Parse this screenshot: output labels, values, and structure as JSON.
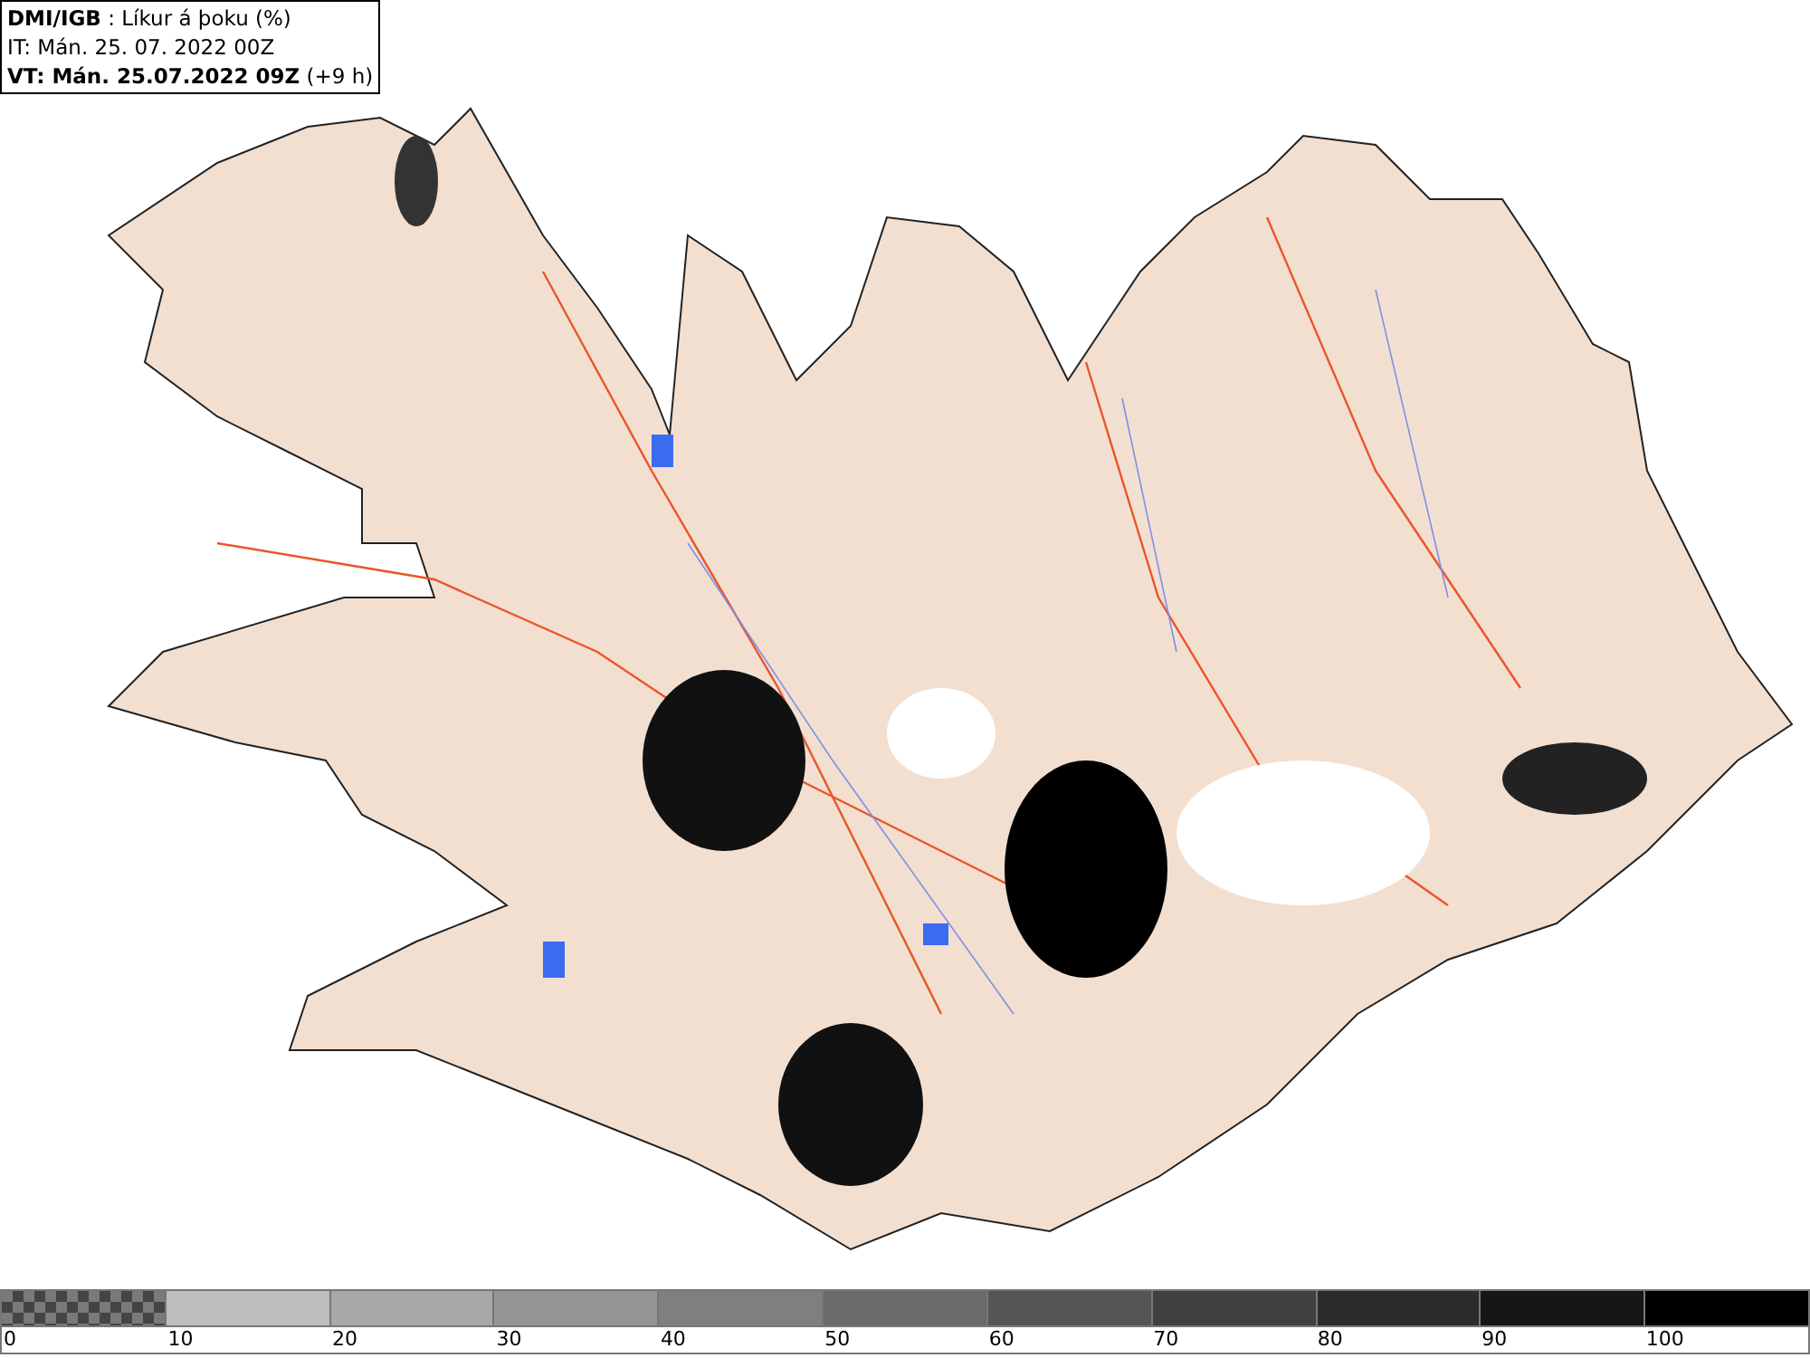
{
  "header": {
    "lines": [
      "**DMI/IGB** : Líkur á þoku (%)",
      "IT: Mán. 25. 07. 2022 00Z",
      "**VT: Mán. 25.07.2022 09Z** (+9 h)"
    ]
  },
  "legend": {
    "segments": [
      {
        "kind": "checker",
        "color": "#7a7a7a"
      },
      {
        "kind": "solid",
        "color": "#bdbdbd"
      },
      {
        "kind": "solid",
        "color": "#a8a8a8"
      },
      {
        "kind": "solid",
        "color": "#959595"
      },
      {
        "kind": "solid",
        "color": "#7f7f7f"
      },
      {
        "kind": "solid",
        "color": "#6a6a6a"
      },
      {
        "kind": "solid",
        "color": "#555555"
      },
      {
        "kind": "solid",
        "color": "#404040"
      },
      {
        "kind": "solid",
        "color": "#2b2b2b"
      },
      {
        "kind": "solid",
        "color": "#161616"
      },
      {
        "kind": "solid",
        "color": "#000000"
      }
    ],
    "labels": [
      "0",
      "10",
      "20",
      "30",
      "40",
      "50",
      "60",
      "70",
      "80",
      "90",
      "100"
    ]
  }
}
